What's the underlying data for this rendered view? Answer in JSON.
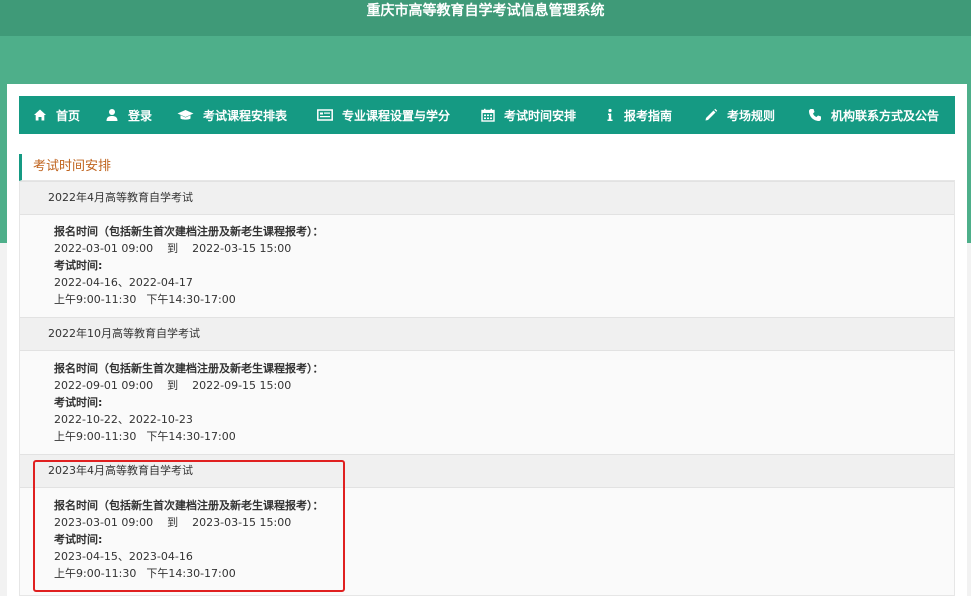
{
  "site": {
    "title": "重庆市高等教育自学考试信息管理系统"
  },
  "nav": {
    "items": [
      {
        "label": "首页",
        "icon": "home-icon"
      },
      {
        "label": "登录",
        "icon": "user-icon"
      },
      {
        "label": "考试课程安排表",
        "icon": "graduation-cap-icon"
      },
      {
        "label": "专业课程设置与学分",
        "icon": "list-card-icon"
      },
      {
        "label": "考试时间安排",
        "icon": "calendar-icon"
      },
      {
        "label": "报考指南",
        "icon": "info-icon"
      },
      {
        "label": "考场规则",
        "icon": "pencil-icon"
      },
      {
        "label": "机构联系方式及公告",
        "icon": "phone-icon"
      }
    ]
  },
  "section": {
    "title": "考试时间安排"
  },
  "exams": [
    {
      "name": "2022年4月高等教育自学考试",
      "reg_label": "报名时间（包括新生首次建档注册及新老生课程报考）：",
      "reg_start": "2022-03-01 09:00",
      "reg_to": "到",
      "reg_end": "2022-03-15 15:00",
      "exam_label": "考试时间:",
      "exam_dates": "2022-04-16、2022-04-17",
      "am": "上午9:00-11:30",
      "pm": "下午14:30-17:00"
    },
    {
      "name": "2022年10月高等教育自学考试",
      "reg_label": "报名时间（包括新生首次建档注册及新老生课程报考）：",
      "reg_start": "2022-09-01 09:00",
      "reg_to": "到",
      "reg_end": "2022-09-15 15:00",
      "exam_label": "考试时间:",
      "exam_dates": "2022-10-22、2022-10-23",
      "am": "上午9:00-11:30",
      "pm": "下午14:30-17:00"
    },
    {
      "name": "2023年4月高等教育自学考试",
      "reg_label": "报名时间（包括新生首次建档注册及新老生课程报考）：",
      "reg_start": "2023-03-01 09:00",
      "reg_to": "到",
      "reg_end": "2023-03-15 15:00",
      "exam_label": "考试时间:",
      "exam_dates": "2023-04-15、2023-04-16",
      "am": "上午9:00-11:30",
      "pm": "下午14:30-17:00"
    }
  ],
  "colors": {
    "brand": "#159a83",
    "header_green": "#4eaf8a",
    "section_title": "#c0641f",
    "highlight": "#e02020"
  }
}
